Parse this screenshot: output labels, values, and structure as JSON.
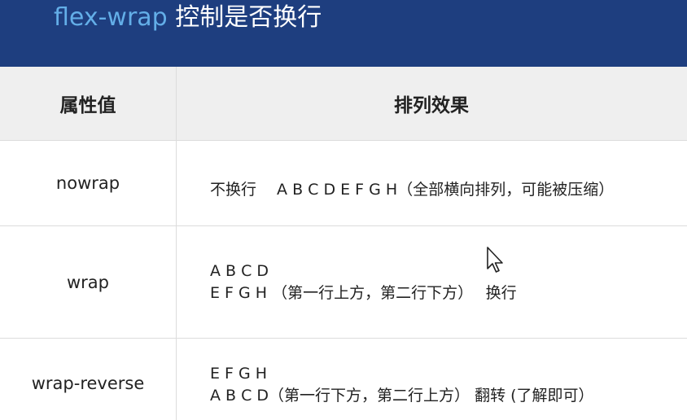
{
  "title": {
    "keyword": "flex-wrap",
    "rest": " 控制是否换行"
  },
  "table": {
    "headers": [
      "属性值",
      "排列效果"
    ],
    "rows": [
      {
        "value": "nowrap",
        "effect_lines": [
          "不换行　 A B C D E F G H（全部横向排列，可能被压缩）"
        ]
      },
      {
        "value": "wrap",
        "effect_lines": [
          "A B C D",
          "E  F G H （第一行上方，第二行下方）　  换行"
        ]
      },
      {
        "value": "wrap-reverse",
        "effect_lines": [
          "E F G H",
          "A B C D（第一行下方，第二行上方） 翻转 (了解即可）"
        ]
      }
    ]
  },
  "colors": {
    "title_bar": "#1e3e7f",
    "title_keyword": "#63aee8",
    "header_bg": "#efefef"
  },
  "icons": {
    "cursor": "mouse-pointer-icon"
  }
}
